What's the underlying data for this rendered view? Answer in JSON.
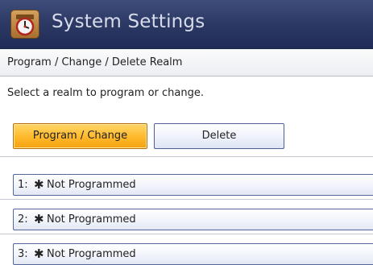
{
  "header": {
    "title": "System Settings"
  },
  "breadcrumb": "Program / Change / Delete Realm",
  "instruction": "Select a realm to program or change.",
  "modes": {
    "program_change": "Program / Change",
    "delete": "Delete",
    "selected": "program_change"
  },
  "realms": [
    {
      "number": "1:",
      "marker": "✱",
      "label": "Not Programmed"
    },
    {
      "number": "2:",
      "marker": "✱",
      "label": "Not Programmed"
    },
    {
      "number": "3:",
      "marker": "✱",
      "label": "Not Programmed"
    }
  ],
  "colors": {
    "titlebar": "#2d3a66",
    "selected_button": "#ffb82a",
    "row_border": "#55669b"
  },
  "icons": {
    "app": "system-settings-clock-icon"
  }
}
